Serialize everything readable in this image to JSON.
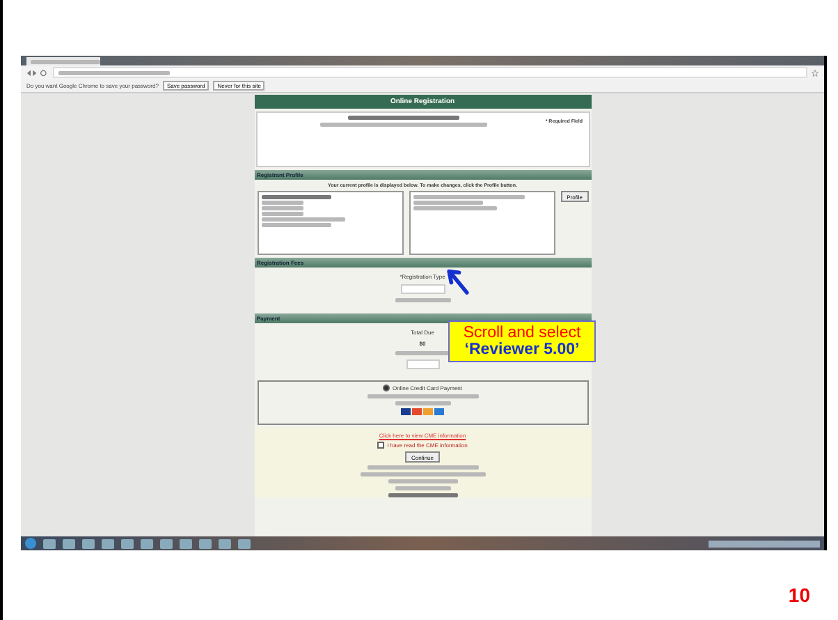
{
  "browser": {
    "infobar": {
      "message": "Do you want Google Chrome to save your password?",
      "buttons": [
        "Save password",
        "Never for this site"
      ]
    }
  },
  "page": {
    "title": "Online Registration",
    "required_note": "* Required Field",
    "profile": {
      "heading": "Registrant Profile",
      "instruction": "Your current profile is displayed below. To make changes, click the Profile button.",
      "button": "Profile"
    },
    "fees": {
      "heading": "Registration Fees",
      "type_label": "*Registration Type"
    },
    "payment": {
      "heading": "Payment",
      "total_label": "Total Due",
      "total": "$0",
      "method": {
        "label": "Online Credit Card Payment",
        "selected": true
      }
    },
    "cme_link": "Click here to view CME information",
    "cme_check": {
      "label": "I have read the CME information",
      "checked": false
    },
    "continue": "Continue"
  },
  "callout": {
    "line_1": "Scroll and select",
    "line_2": "‘Reviewer 5.00’"
  },
  "slide_number": "10"
}
